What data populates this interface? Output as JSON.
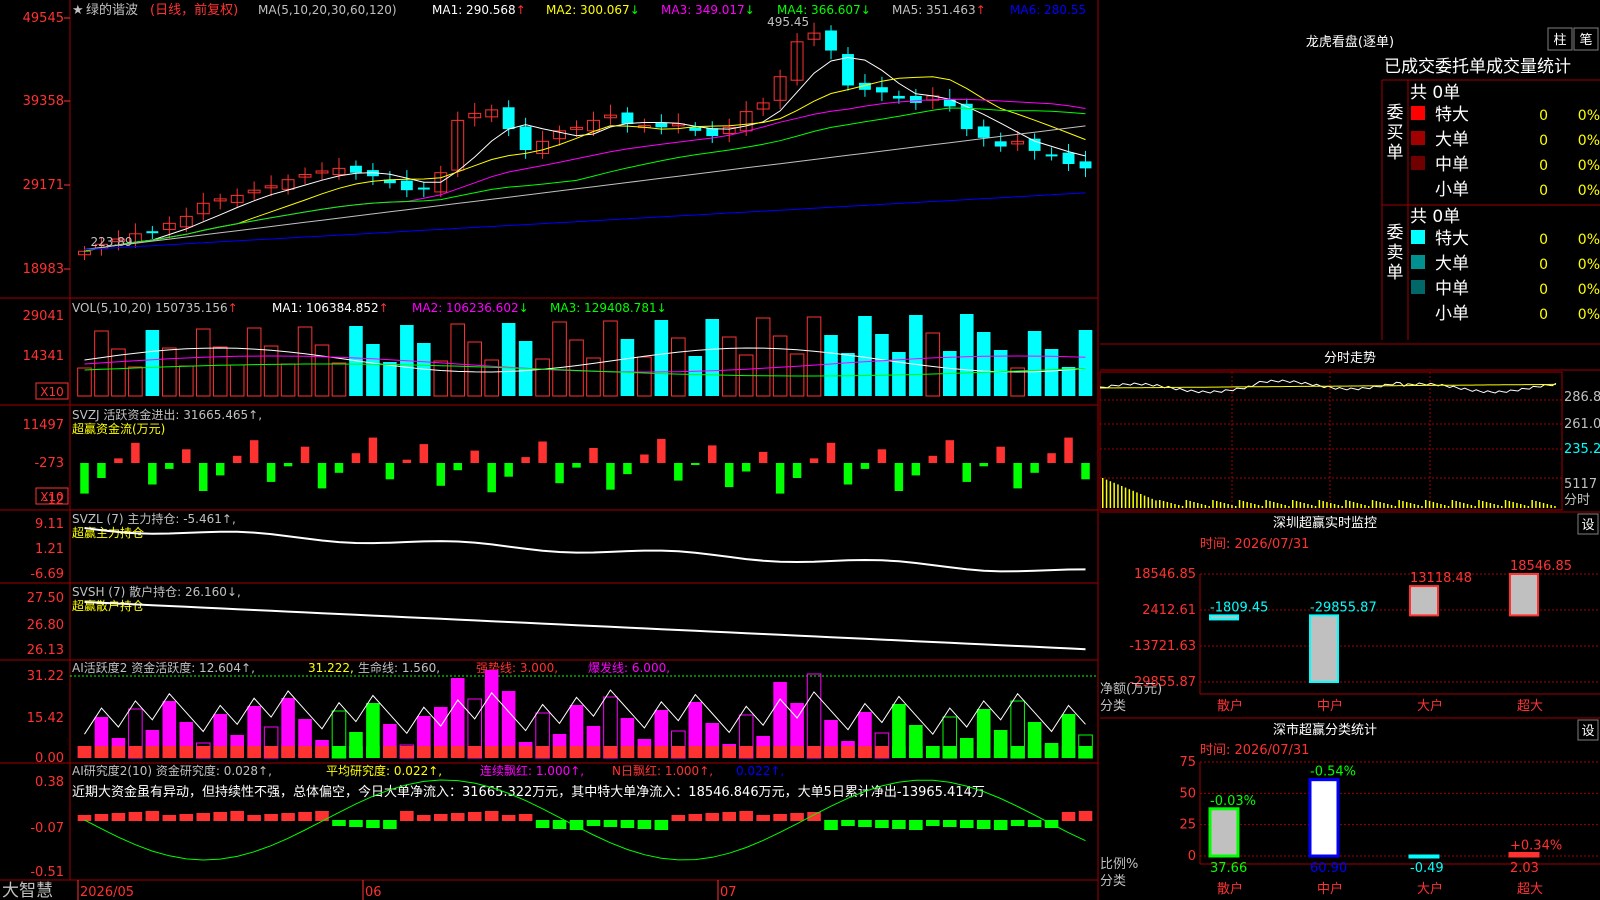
{
  "header": {
    "star": "★",
    "stock_name": "绿的谐波",
    "period": "(日线，前复权)",
    "ma_params": "MA(5,10,20,30,60,120)",
    "ma": [
      {
        "label": "MA1:",
        "value": "290.568",
        "arrow": "↑",
        "color": "#ffffff"
      },
      {
        "label": "MA2:",
        "value": "300.067",
        "arrow": "↓",
        "color": "#ffff00"
      },
      {
        "label": "MA3:",
        "value": "349.017",
        "arrow": "↓",
        "color": "#ff00ff"
      },
      {
        "label": "MA4:",
        "value": "366.607",
        "arrow": "↓",
        "color": "#00ff00"
      },
      {
        "label": "MA5:",
        "value": "351.463",
        "arrow": "↑",
        "color": "#c0c0c0"
      },
      {
        "label": "MA6:",
        "value": "280.55",
        "arrow": "",
        "color": "#0000ff"
      }
    ]
  },
  "main_chart": {
    "y_ticks": [
      "49545",
      "39358",
      "29171",
      "18983"
    ],
    "high_label": "495.45",
    "low_label": "223.89"
  },
  "vol_panel": {
    "title": "VOL(5,10,20)",
    "value": "150735.156",
    "arrow": "↑",
    "ma1_label": "MA1:",
    "ma1": "106384.852",
    "ma1_arrow": "↑",
    "ma2_label": "MA2:",
    "ma2": "106236.602",
    "ma2_arrow": "↓",
    "ma3_label": "MA3:",
    "ma3": "129408.781",
    "ma3_arrow": "↓",
    "y_ticks": [
      "29041",
      "14341"
    ],
    "unit": "X10"
  },
  "svzj_panel": {
    "title": "SVZJ  活跃资金进出: 31665.465↑,",
    "subtitle": "超赢资金流(万元)",
    "y_ticks": [
      "11497",
      "-273",
      "-12"
    ],
    "unit": "X10"
  },
  "svzl_panel": {
    "title": "SVZL (7) 主力持仓: -5.461↑,",
    "subtitle": "超赢主力持仓",
    "y_ticks": [
      "9.11",
      "1.21",
      "-6.69"
    ]
  },
  "svsh_panel": {
    "title": "SVSH (7) 散户持仓: 26.160↓,",
    "subtitle": "超赢散户持仓",
    "y_ticks": [
      "27.50",
      "26.80",
      "26.13"
    ]
  },
  "ai_active": {
    "title": "AI活跃度2 资金活跃度: 12.604↑,",
    "v2": "31.222,",
    "v3": "生命线: 1.560,",
    "v4": "强势线: 3.000,",
    "v5": "爆发线: 6.000,",
    "y_ticks": [
      "31.22",
      "15.42",
      "0.00"
    ]
  },
  "ai_research": {
    "title": "AI研究度2(10) 资金研究度: 0.028↑,",
    "avg": "平均研究度: 0.022↑,",
    "lian": "连续飘红: 1.000↑,",
    "nday": "N日飘红: 1.000↑,",
    "last": "0.022↑,",
    "comment": "近期大资金虽有异动，但持续性不强，总体偏空，今日大单净流入：31665.322万元，其中特大单净流入：18546.846万元，大单5日累计净出-13965.414万",
    "y_ticks": [
      "0.38",
      "-0.07",
      "-0.51"
    ]
  },
  "x_axis": {
    "brand": "大智慧",
    "labels": [
      "2026/05",
      "06",
      "07"
    ]
  },
  "right": {
    "dragon_title": "龙虎看盘(逐单)",
    "btn_zhu": "柱",
    "btn_bi": "笔",
    "tabs_label": "已成交委托单成交量统计",
    "buy_label": "委买单",
    "sell_label": "委卖单",
    "buy_total": "共 0单",
    "sell_total": "共 0单",
    "buy_rows": [
      {
        "name": "特大",
        "count": "0",
        "pct": "0%",
        "color": "#ff0000"
      },
      {
        "name": "大单",
        "count": "0",
        "pct": "0%",
        "color": "#a00000"
      },
      {
        "name": "中单",
        "count": "0",
        "pct": "0%",
        "color": "#700000"
      },
      {
        "name": "小单",
        "count": "0",
        "pct": "0%",
        "color": ""
      }
    ],
    "sell_rows": [
      {
        "name": "特大",
        "count": "0",
        "pct": "0%",
        "color": "#00ffff"
      },
      {
        "name": "大单",
        "count": "0",
        "pct": "0%",
        "color": "#009090"
      },
      {
        "name": "中单",
        "count": "0",
        "pct": "0%",
        "color": "#006868"
      },
      {
        "name": "小单",
        "count": "0",
        "pct": "0%",
        "color": ""
      }
    ],
    "fenshi_title": "分时走势",
    "fenshi_ticks": [
      "286.8",
      "261.0",
      "235.2",
      "5117"
    ],
    "fenshi_unit": "分时",
    "monitor_title": "深圳超赢实时监控",
    "monitor_btn": "设",
    "monitor_time": "时间: 2026/07/31",
    "monitor_yticks": [
      "18546.85",
      "2412.61",
      "-13721.63",
      "-29855.87"
    ],
    "monitor_ylabel": "净额(万元)",
    "monitor_xlabel": "分类",
    "class_title": "深市超赢分类统计",
    "class_btn": "设",
    "class_time": "时间: 2026/07/31",
    "class_yticks": [
      "75",
      "50",
      "25",
      "0"
    ],
    "class_ylabel": "比例%",
    "class_xlabel": "分类"
  },
  "chart_data": [
    {
      "type": "bar",
      "title": "深圳超赢实时监控",
      "ylabel": "净额(万元)",
      "xlabel": "分类",
      "categories": [
        "散户",
        "中户",
        "大户",
        "超大"
      ],
      "values": [
        -1809.45,
        -29855.87,
        13118.48,
        18546.85
      ],
      "value_labels": [
        "-1809.45",
        "-29855.87",
        "13118.48",
        "18546.85"
      ],
      "ylim": [
        -29855.87,
        18546.85
      ]
    },
    {
      "type": "bar",
      "title": "深市超赢分类统计",
      "ylabel": "比例%",
      "xlabel": "分类",
      "categories": [
        "散户",
        "中户",
        "大户",
        "超大"
      ],
      "values": [
        37.66,
        60.9,
        -0.49,
        2.03
      ],
      "value_labels": [
        "37.66",
        "60.90",
        "-0.49",
        "2.03"
      ],
      "change_labels": [
        "-0.03%",
        "-0.54%",
        "",
        "+0.34%"
      ],
      "ylim": [
        0,
        75
      ]
    }
  ]
}
